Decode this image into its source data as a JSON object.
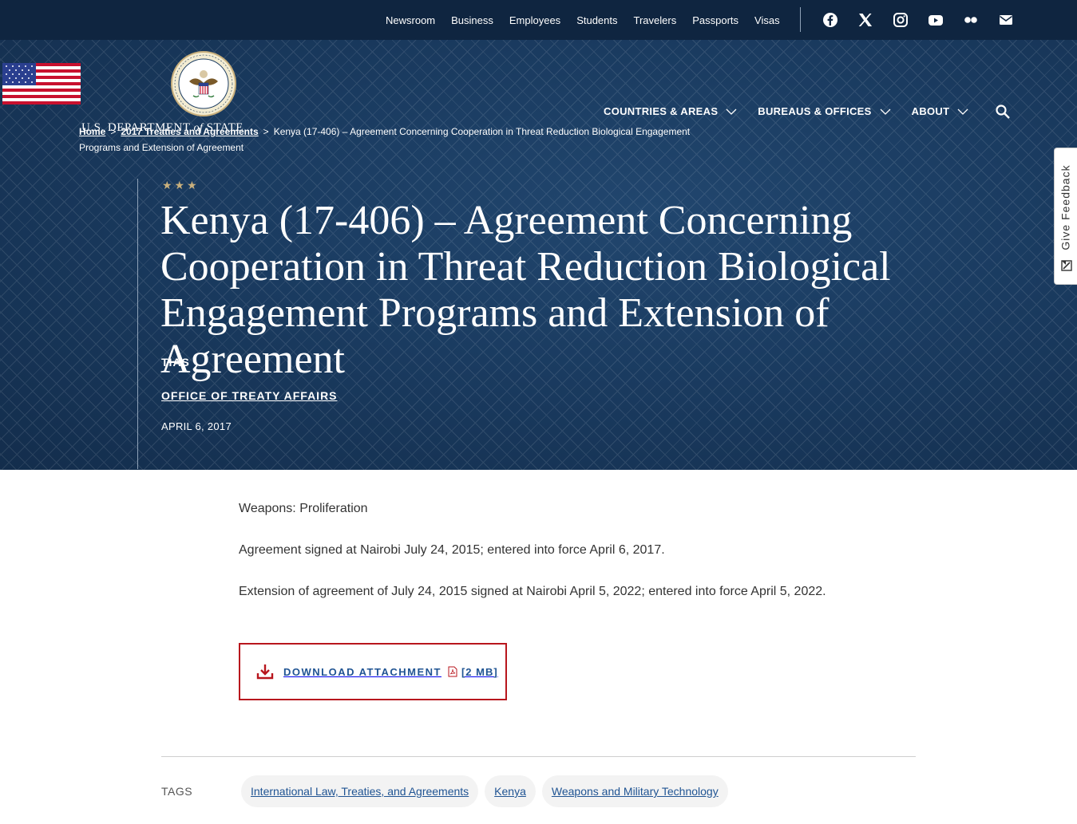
{
  "top_nav": {
    "links": [
      "Newsroom",
      "Business",
      "Employees",
      "Students",
      "Travelers",
      "Passports",
      "Visas"
    ],
    "social_icons": [
      "facebook-icon",
      "x-icon",
      "instagram-icon",
      "youtube-icon",
      "flickr-icon",
      "email-icon"
    ]
  },
  "logo": {
    "line1": "U.S. DEPARTMENT",
    "of": "of",
    "line2": "STATE"
  },
  "main_nav": {
    "items": [
      "COUNTRIES & AREAS",
      "BUREAUS & OFFICES",
      "ABOUT"
    ]
  },
  "breadcrumb": {
    "home": "Home",
    "parent": "2017 Treaties and Agreements",
    "current": "Kenya (17-406) – Agreement Concerning Cooperation in Threat Reduction Biological Engagement Programs and Extension of Agreement",
    "separator": ">"
  },
  "hero": {
    "stars": "★★★",
    "title": "Kenya (17-406) – Agreement Concerning Cooperation in Threat Reduction Biological Engagement Programs and Extension of Agreement",
    "bureau": "TIAS",
    "office": "OFFICE OF TREATY AFFAIRS",
    "date": "APRIL 6, 2017"
  },
  "feedback": {
    "label": "Give Feedback"
  },
  "content": {
    "p1": "Weapons: Proliferation",
    "p2": "Agreement signed at Nairobi July 24, 2015; entered into force April 6, 2017.",
    "p3": "Extension of agreement of July 24, 2015 signed at Nairobi April 5, 2022; entered into force April 5, 2022."
  },
  "download": {
    "label": "DOWNLOAD ATTACHMENT",
    "size": "[2 MB]"
  },
  "tags": {
    "label": "TAGS",
    "items": [
      "International Law, Treaties, and Agreements",
      "Kenya",
      "Weapons and Military Technology"
    ]
  },
  "colors": {
    "navy": "#0f2540",
    "hero": "#1a3b60",
    "accent_red": "#b8161d",
    "link_blue": "#205493",
    "gold": "#c9b07d"
  }
}
